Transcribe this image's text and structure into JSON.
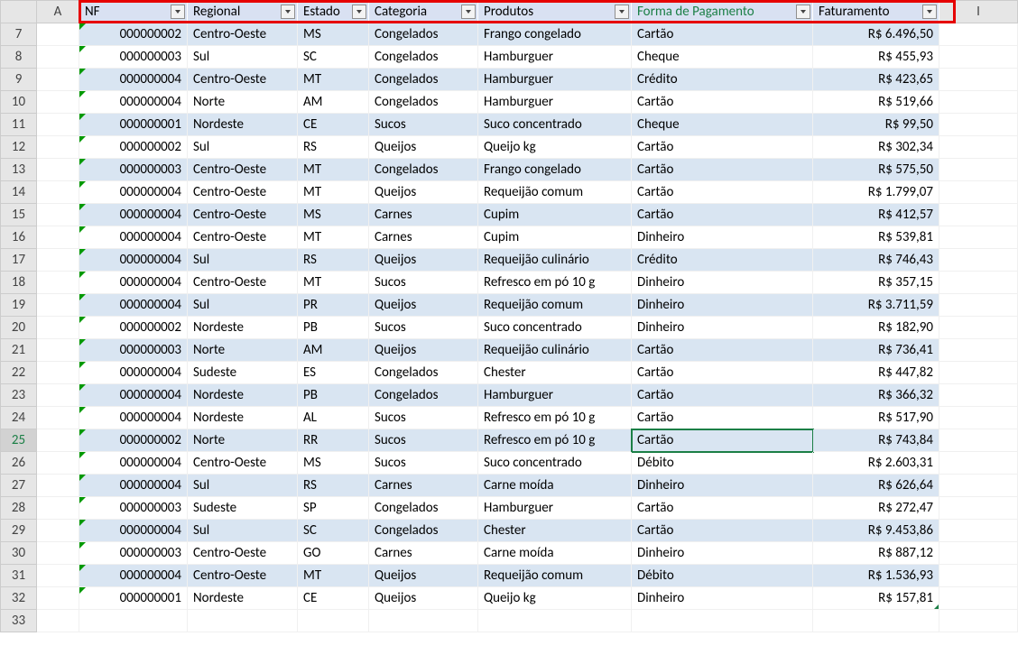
{
  "columnLetters": [
    "",
    "A",
    "",
    "",
    "",
    "",
    "",
    "",
    "",
    "I"
  ],
  "rowStart": 7,
  "selectedRow": 25,
  "selectedCol": 6,
  "activeHeaderIndex": 5,
  "headers": [
    {
      "label": "NF"
    },
    {
      "label": "Regional"
    },
    {
      "label": "Estado"
    },
    {
      "label": "Categoria"
    },
    {
      "label": "Produtos"
    },
    {
      "label": "Forma de Pagamento"
    },
    {
      "label": "Faturamento"
    }
  ],
  "rows": [
    {
      "nf": "000000002",
      "reg": "Centro-Oeste",
      "est": "MS",
      "cat": "Congelados",
      "prod": "Frango congelado",
      "pag": "Cartão",
      "fat": "R$ 6.496,50"
    },
    {
      "nf": "000000003",
      "reg": "Sul",
      "est": "SC",
      "cat": "Congelados",
      "prod": "Hamburguer",
      "pag": "Cheque",
      "fat": "R$ 455,93"
    },
    {
      "nf": "000000004",
      "reg": "Centro-Oeste",
      "est": "MT",
      "cat": "Congelados",
      "prod": "Hamburguer",
      "pag": "Crédito",
      "fat": "R$ 423,65"
    },
    {
      "nf": "000000004",
      "reg": "Norte",
      "est": "AM",
      "cat": "Congelados",
      "prod": "Hamburguer",
      "pag": "Cartão",
      "fat": "R$ 519,66"
    },
    {
      "nf": "000000001",
      "reg": "Nordeste",
      "est": "CE",
      "cat": "Sucos",
      "prod": "Suco concentrado",
      "pag": "Cheque",
      "fat": "R$ 99,50"
    },
    {
      "nf": "000000002",
      "reg": "Sul",
      "est": "RS",
      "cat": "Queijos",
      "prod": "Queijo kg",
      "pag": "Cartão",
      "fat": "R$ 302,34"
    },
    {
      "nf": "000000003",
      "reg": "Centro-Oeste",
      "est": "MT",
      "cat": "Congelados",
      "prod": "Frango congelado",
      "pag": "Cartão",
      "fat": "R$ 575,50"
    },
    {
      "nf": "000000004",
      "reg": "Centro-Oeste",
      "est": "MT",
      "cat": "Queijos",
      "prod": "Requeijão comum",
      "pag": "Cartão",
      "fat": "R$ 1.799,07"
    },
    {
      "nf": "000000004",
      "reg": "Centro-Oeste",
      "est": "MS",
      "cat": "Carnes",
      "prod": "Cupim",
      "pag": "Cartão",
      "fat": "R$ 412,57"
    },
    {
      "nf": "000000004",
      "reg": "Centro-Oeste",
      "est": "MT",
      "cat": "Carnes",
      "prod": "Cupim",
      "pag": "Dinheiro",
      "fat": "R$ 539,81"
    },
    {
      "nf": "000000004",
      "reg": "Sul",
      "est": "RS",
      "cat": "Queijos",
      "prod": "Requeijão culinário",
      "pag": "Crédito",
      "fat": "R$ 746,43"
    },
    {
      "nf": "000000004",
      "reg": "Centro-Oeste",
      "est": "MT",
      "cat": "Sucos",
      "prod": "Refresco em pó 10 g",
      "pag": "Dinheiro",
      "fat": "R$ 357,15"
    },
    {
      "nf": "000000004",
      "reg": "Sul",
      "est": "PR",
      "cat": "Queijos",
      "prod": "Requeijão comum",
      "pag": "Dinheiro",
      "fat": "R$ 3.711,59"
    },
    {
      "nf": "000000002",
      "reg": "Nordeste",
      "est": "PB",
      "cat": "Sucos",
      "prod": "Suco concentrado",
      "pag": "Dinheiro",
      "fat": "R$ 182,90"
    },
    {
      "nf": "000000003",
      "reg": "Norte",
      "est": "AM",
      "cat": "Queijos",
      "prod": "Requeijão culinário",
      "pag": "Cartão",
      "fat": "R$ 736,41"
    },
    {
      "nf": "000000004",
      "reg": "Sudeste",
      "est": "ES",
      "cat": "Congelados",
      "prod": "Chester",
      "pag": "Cartão",
      "fat": "R$ 447,82"
    },
    {
      "nf": "000000004",
      "reg": "Nordeste",
      "est": "PB",
      "cat": "Congelados",
      "prod": "Hamburguer",
      "pag": "Cartão",
      "fat": "R$ 366,32"
    },
    {
      "nf": "000000004",
      "reg": "Nordeste",
      "est": "AL",
      "cat": "Sucos",
      "prod": "Refresco em pó 10 g",
      "pag": "Cartão",
      "fat": "R$ 517,90"
    },
    {
      "nf": "000000002",
      "reg": "Norte",
      "est": "RR",
      "cat": "Sucos",
      "prod": "Refresco em pó 10 g",
      "pag": "Cartão",
      "fat": "R$ 743,84"
    },
    {
      "nf": "000000004",
      "reg": "Centro-Oeste",
      "est": "MS",
      "cat": "Sucos",
      "prod": "Suco concentrado",
      "pag": "Débito",
      "fat": "R$ 2.603,31"
    },
    {
      "nf": "000000004",
      "reg": "Sul",
      "est": "RS",
      "cat": "Carnes",
      "prod": "Carne moída",
      "pag": "Dinheiro",
      "fat": "R$ 626,64"
    },
    {
      "nf": "000000003",
      "reg": "Sudeste",
      "est": "SP",
      "cat": "Congelados",
      "prod": "Hamburguer",
      "pag": "Cartão",
      "fat": "R$ 272,47"
    },
    {
      "nf": "000000004",
      "reg": "Sul",
      "est": "SC",
      "cat": "Congelados",
      "prod": "Chester",
      "pag": "Cartão",
      "fat": "R$ 9.453,86"
    },
    {
      "nf": "000000003",
      "reg": "Centro-Oeste",
      "est": "GO",
      "cat": "Carnes",
      "prod": "Carne moída",
      "pag": "Dinheiro",
      "fat": "R$ 887,12"
    },
    {
      "nf": "000000004",
      "reg": "Centro-Oeste",
      "est": "MT",
      "cat": "Queijos",
      "prod": "Requeijão comum",
      "pag": "Débito",
      "fat": "R$ 1.536,93"
    },
    {
      "nf": "000000001",
      "reg": "Nordeste",
      "est": "CE",
      "cat": "Queijos",
      "prod": "Queijo kg",
      "pag": "Dinheiro",
      "fat": "R$ 157,81"
    }
  ]
}
